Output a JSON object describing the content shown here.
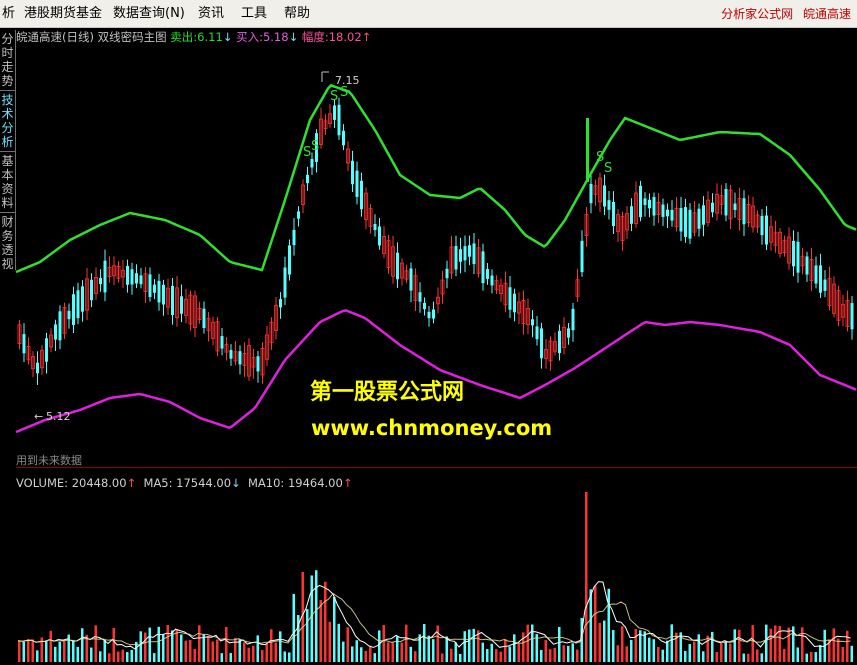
{
  "menu": {
    "items": [
      "析",
      "港股期货基金",
      "数据查询(N)",
      "资讯",
      "工具",
      "帮助"
    ],
    "right_site": "分析家公式网",
    "right_stock": "皖通高速"
  },
  "sidebar": {
    "tabs": [
      "分时走势",
      "技术分析",
      "基本资料",
      "财务透视"
    ],
    "active_index": 1
  },
  "chart_header": {
    "stock": "皖通高速(日线)",
    "indicator": "双线密码主图",
    "sell_label": "卖出:",
    "sell_value": "6.11",
    "buy_label": "买入:",
    "buy_value": "5.18",
    "amp_label": "幅度:",
    "amp_value": "18.02"
  },
  "annotations": {
    "high_label": "7.15",
    "low_label": "5.12",
    "signal_letter": "S",
    "future_note": "用到未来数据"
  },
  "watermark": {
    "line1": "第一股票公式网",
    "line2": "www.chnmoney.com"
  },
  "volume_header": {
    "volume_label": "VOLUME:",
    "volume_value": "20448.00",
    "ma5_label": "MA5:",
    "ma5_value": "17544.00",
    "ma10_label": "MA10:",
    "ma10_value": "19464.00"
  },
  "colors": {
    "up_candle": "#ff3232",
    "down_candle": "#54ffff",
    "sell_line": "#2fe02f",
    "buy_line": "#e020e0",
    "grid": "#8b0000",
    "volume_ma": "#ffffff"
  },
  "chart_data": {
    "type": "candlestick",
    "price_range": [
      4.6,
      7.3
    ],
    "annotated_high": 7.15,
    "annotated_low": 5.12,
    "sell_line_last": 6.11,
    "buy_line_last": 5.18,
    "amplitude_pct": 18.02,
    "volume_last": 20448.0,
    "volume_ma5_last": 17544.0,
    "volume_ma10_last": 19464.0
  }
}
